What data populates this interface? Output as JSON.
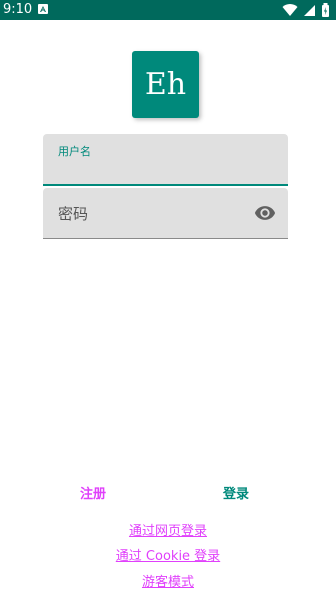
{
  "status_bar": {
    "time": "9:10",
    "icons": [
      "notification-a-icon",
      "wifi-icon",
      "signal-icon",
      "battery-icon"
    ],
    "color": "#00695c"
  },
  "logo": {
    "text": "Eh",
    "color": "#00897b"
  },
  "form": {
    "username_label": "用户名",
    "username_value": "",
    "password_placeholder": "密码",
    "password_visibility_icon": "eye-icon"
  },
  "actions": {
    "register_label": "注册",
    "login_label": "登录"
  },
  "links": {
    "web_login": "通过网页登录",
    "cookie_login": "通过 Cookie 登录",
    "guest_mode": "游客模式"
  },
  "colors": {
    "accent": "#00897b",
    "link": "#e040fb"
  }
}
